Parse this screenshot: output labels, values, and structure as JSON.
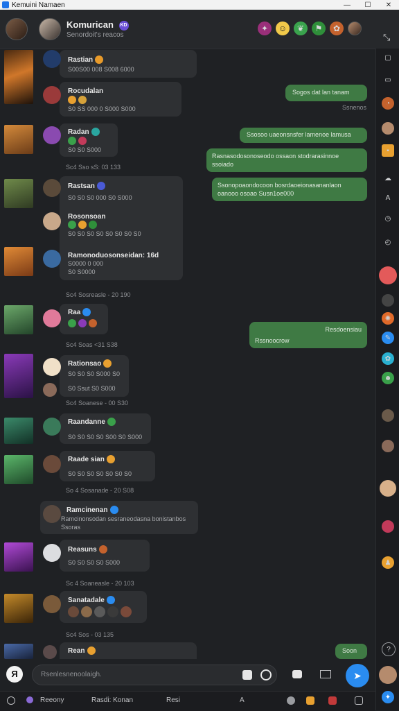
{
  "window": {
    "title": "Kemuini Namaen",
    "controls": {
      "minimize": "—",
      "maximize": "☐",
      "close": "✕"
    }
  },
  "header": {
    "name": "Komurican",
    "badge": "KD",
    "subtitle": "Senordoit's reacos",
    "expand_icon": "⤡",
    "reaction_icons": [
      "party-icon",
      "smile-icon",
      "leaf-icon",
      "flag-icon",
      "gift-icon",
      "avatar"
    ]
  },
  "incoming": [
    {
      "name": "Rastian",
      "line1": "S00S00 008 S008 6000",
      "time": ""
    },
    {
      "name": "Rocudalan",
      "line1": "S0 SS 000 0 S000 S000",
      "time": ""
    },
    {
      "name": "Radan",
      "line1": "S0 S0 S000",
      "time": "Sc4 Sso sS: 03 133"
    },
    {
      "name": "Rastsan",
      "line1": "S0 S0 S0 000 S0 S000",
      "time": ""
    },
    {
      "name": "Rosonsoan",
      "line1": "S0 S0 S0 S0 S0 S0 S0 S0",
      "time": ""
    },
    {
      "name": "Ramonoduosonseidan: 16d",
      "line1": "S0000 0 000",
      "line2": "S0 S0000",
      "time": "Sc4 Sosreasle - 20 190"
    },
    {
      "name": "Raa",
      "line1": "",
      "time": "Sc4 Soas <31 S38"
    },
    {
      "name": "Rationsao",
      "line1": "S0 S0 S0 S000 S0",
      "line2": "S0 Ssut S0 S000",
      "time": "Sc4 Soanese - 00 S30"
    },
    {
      "name": "Raandanne",
      "line1": "S0 S0 S0 S0 S00 S0 S000",
      "time": ""
    },
    {
      "name": "Raade sian",
      "line1": "S0 S0 S0 S0 S0 S0 S0",
      "time": "So 4 Sosanade - 20 S08"
    },
    {
      "name": "Ramcinenan",
      "line1": "Ramcinonsodan sesraneodasna bonistanbos",
      "line2": "Ssoras",
      "time": ""
    },
    {
      "name": "Reasuns",
      "line1": "S0 S0 S0 S0 S000",
      "time": "Sc 4 Soaneasle - 20 103"
    },
    {
      "name": "Sanatadale",
      "line1": "",
      "time": "Sc4 Sos - 03 135"
    },
    {
      "name": "Rean",
      "line1": "",
      "time": ""
    }
  ],
  "outgoing": [
    {
      "text": "Sogos dat lan tanam",
      "status": "Ssnenos"
    },
    {
      "text": "Ssosoo uaeonsnsfer lamenoe lamusa"
    },
    {
      "text": "Rasnasodosonoseodo ossaon stodrarasinnoe ssoiado"
    },
    {
      "text": "Ssonopoaondocoon bosrdaoeionasananlaon oanooo osoao Susn1oe000"
    },
    {
      "text": "Resdoensiau",
      "sub": "Rssnoocrow"
    },
    {
      "text": "Soon"
    }
  ],
  "composer": {
    "attach_icon": "Я",
    "placeholder": "Rsenlesnenoolaigh.",
    "send_icon": "➤"
  },
  "bottom_bar": {
    "items": [
      "Reeony",
      "Rasdi: Konan",
      "Resi"
    ]
  },
  "colors": {
    "background": "#1f2124",
    "incoming_bubble": "#2e3033",
    "outgoing_bubble": "#3f7a44",
    "accent": "#2a8cf0",
    "tab_underline": "#3ec6d4"
  }
}
